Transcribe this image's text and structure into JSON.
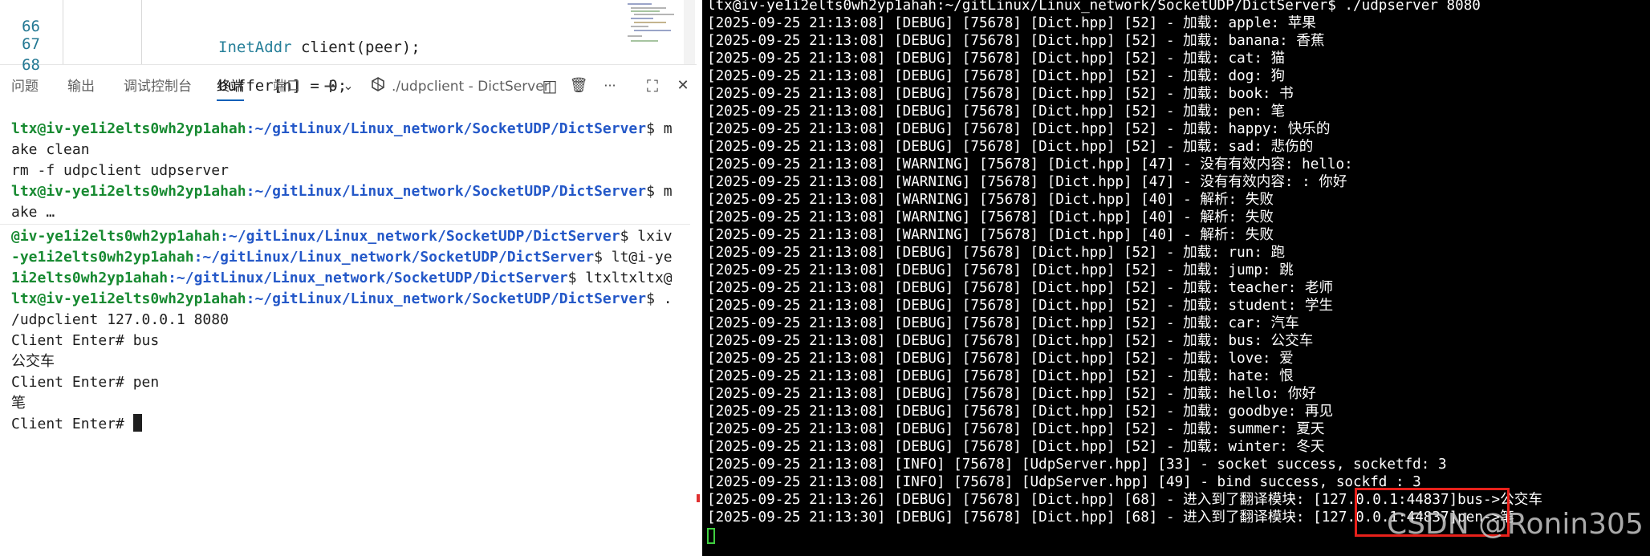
{
  "editor": {
    "lines": [
      {
        "num": "66",
        "code_type": "InetAddr",
        "code_rest": " client(peer);"
      },
      {
        "num": "67",
        "code_type": "",
        "code_rest": ""
      },
      {
        "num": "68",
        "code_type": "",
        "code_rest": "buffer[n] = 0;"
      }
    ]
  },
  "panel": {
    "tabs": [
      "问题",
      "输出",
      "调试控制台",
      "终端",
      "端口"
    ],
    "active_tab": "终端",
    "plus_icon": "+",
    "chevron_icon": "⌄",
    "terminal_name": "./udpclient - DictServer",
    "split_icon": "◫",
    "trash_icon": "🗑",
    "more_icon": "···",
    "maximize_icon": "⛶",
    "close_icon": "✕"
  },
  "vs_terminal": {
    "line1_user": "ltx@iv-ye1i2elts0wh2yp1ahah",
    "line1_path": ":~/gitLinux/Linux_network/SocketUDP/DictServer",
    "line1_tail": "$ m",
    "line2": "ake clean",
    "line3": "rm -f udpclient udpserver",
    "line4_user": "ltx@iv-ye1i2elts0wh2yp1ahah",
    "line4_path": ":~/gitLinux/Linux_network/SocketUDP/DictServer",
    "line4_tail": "$ m",
    "line5": "ake …",
    "line6_user": "@iv-ye1i2elts0wh2yp1ahah",
    "line6_path": ":~/gitLinux/Linux_network/SocketUDP/DictServer",
    "line6_tail": "$ lxiv",
    "line7_user": "-ye1i2elts0wh2yp1ahah",
    "line7_path": ":~/gitLinux/Linux_network/SocketUDP/DictServer",
    "line7_tail": "$ lt@i-ye",
    "line8_user": "1i2elts0wh2yp1ahah",
    "line8_path": ":~/gitLinux/Linux_network/SocketUDP/DictServer",
    "line8_tail": "$ ltxltxltx@",
    "line9_user": "ltx@iv-ye1i2elts0wh2yp1ahah",
    "line9_path": ":~/gitLinux/Linux_network/SocketUDP/DictServer",
    "line9_tail": "$ .",
    "line10": "/udpclient 127.0.0.1 8080",
    "line11": "Client Enter# bus",
    "line12": "公交车",
    "line13": "Client Enter# pen",
    "line14": "笔",
    "line15": "Client Enter# "
  },
  "server_terminal": {
    "lines": [
      "ltx@iv-ye1i2elts0wh2yp1ahah:~/gitLinux/Linux_network/SocketUDP/DictServer$ ./udpserver 8080",
      "[2025-09-25 21:13:08] [DEBUG] [75678] [Dict.hpp] [52] - 加载: apple: 苹果",
      "[2025-09-25 21:13:08] [DEBUG] [75678] [Dict.hpp] [52] - 加载: banana: 香蕉",
      "[2025-09-25 21:13:08] [DEBUG] [75678] [Dict.hpp] [52] - 加载: cat: 猫",
      "[2025-09-25 21:13:08] [DEBUG] [75678] [Dict.hpp] [52] - 加载: dog: 狗",
      "[2025-09-25 21:13:08] [DEBUG] [75678] [Dict.hpp] [52] - 加载: book: 书",
      "[2025-09-25 21:13:08] [DEBUG] [75678] [Dict.hpp] [52] - 加载: pen: 笔",
      "[2025-09-25 21:13:08] [DEBUG] [75678] [Dict.hpp] [52] - 加载: happy: 快乐的",
      "[2025-09-25 21:13:08] [DEBUG] [75678] [Dict.hpp] [52] - 加载: sad: 悲伤的",
      "[2025-09-25 21:13:08] [WARNING] [75678] [Dict.hpp] [47] - 没有有效内容: hello:",
      "[2025-09-25 21:13:08] [WARNING] [75678] [Dict.hpp] [47] - 没有有效内容: : 你好",
      "[2025-09-25 21:13:08] [WARNING] [75678] [Dict.hpp] [40] - 解析: 失败",
      "[2025-09-25 21:13:08] [WARNING] [75678] [Dict.hpp] [40] - 解析: 失败",
      "[2025-09-25 21:13:08] [WARNING] [75678] [Dict.hpp] [40] - 解析: 失败",
      "[2025-09-25 21:13:08] [DEBUG] [75678] [Dict.hpp] [52] - 加载: run: 跑",
      "[2025-09-25 21:13:08] [DEBUG] [75678] [Dict.hpp] [52] - 加载: jump: 跳",
      "[2025-09-25 21:13:08] [DEBUG] [75678] [Dict.hpp] [52] - 加载: teacher: 老师",
      "[2025-09-25 21:13:08] [DEBUG] [75678] [Dict.hpp] [52] - 加载: student: 学生",
      "[2025-09-25 21:13:08] [DEBUG] [75678] [Dict.hpp] [52] - 加载: car: 汽车",
      "[2025-09-25 21:13:08] [DEBUG] [75678] [Dict.hpp] [52] - 加载: bus: 公交车",
      "[2025-09-25 21:13:08] [DEBUG] [75678] [Dict.hpp] [52] - 加载: love: 爱",
      "[2025-09-25 21:13:08] [DEBUG] [75678] [Dict.hpp] [52] - 加载: hate: 恨",
      "[2025-09-25 21:13:08] [DEBUG] [75678] [Dict.hpp] [52] - 加载: hello: 你好",
      "[2025-09-25 21:13:08] [DEBUG] [75678] [Dict.hpp] [52] - 加载: goodbye: 再见",
      "[2025-09-25 21:13:08] [DEBUG] [75678] [Dict.hpp] [52] - 加载: summer: 夏天",
      "[2025-09-25 21:13:08] [DEBUG] [75678] [Dict.hpp] [52] - 加载: winter: 冬天",
      "[2025-09-25 21:13:08] [INFO] [75678] [UdpServer.hpp] [33] - socket success, socketfd: 3",
      "[2025-09-25 21:13:08] [INFO] [75678] [UdpServer.hpp] [49] - bind success, sockfd : 3",
      "[2025-09-25 21:13:26] [DEBUG] [75678] [Dict.hpp] [68] - 进入到了翻译模块: [127.0.0.1:44837]bus->公交车",
      "[2025-09-25 21:13:30] [DEBUG] [75678] [Dict.hpp] [68] - 进入到了翻译模块: [127.0.0.1:44837]pen->笔"
    ]
  },
  "watermark": "CSDN @Ronin305"
}
